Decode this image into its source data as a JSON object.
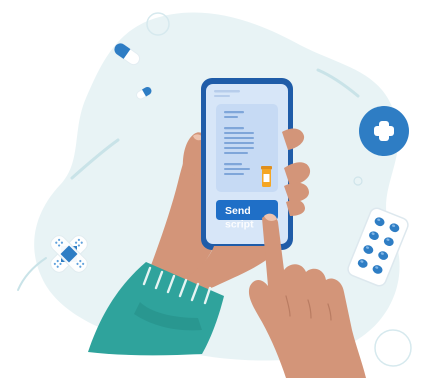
{
  "illustration": {
    "phone_screen": {
      "send_button": {
        "line1": "Send",
        "line2": "script"
      }
    },
    "icons": [
      "capsule-pill-icon",
      "small-capsule-icon",
      "medical-plus-icon",
      "bandage-icon",
      "blister-pack-icon",
      "prescription-bottle-icon"
    ],
    "colors": {
      "background_blob": "#E8F3F5",
      "phone_frame": "#1F5CA8",
      "phone_screen": "#D7E6F8",
      "document_card": "#C6DAF4",
      "button": "#1F6FC7",
      "sleeve": "#2FA39C",
      "skin": "#D39579",
      "medical_blue": "#2E7DC4",
      "bottle_orange": "#F5A623"
    }
  }
}
